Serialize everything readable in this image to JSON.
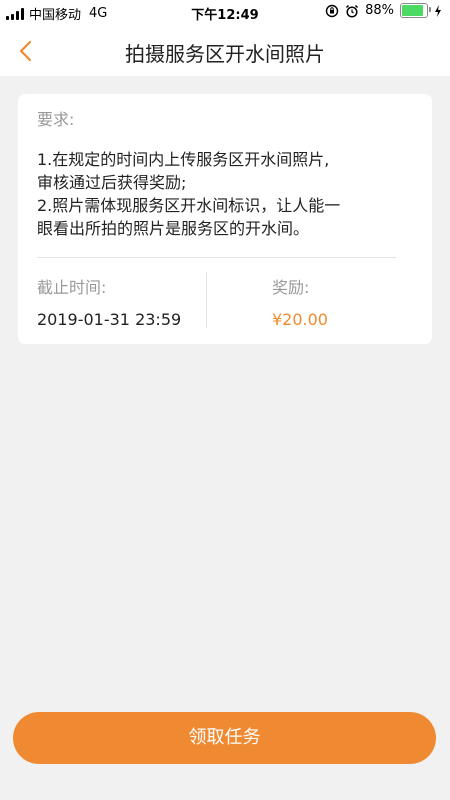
{
  "status_bar": {
    "carrier": "中国移动",
    "network": "4G",
    "time": "下午12:49",
    "battery_percent": "88%",
    "battery_level": 0.88,
    "battery_color": "#4cd964"
  },
  "nav": {
    "back_icon": "chevron-left-icon",
    "title": "拍摄服务区开水间照片",
    "accent_color": "#f08a32"
  },
  "task": {
    "requirements_label": "要求:",
    "requirements_text": "1.在规定的时间内上传服务区开水间照片,\n审核通过后获得奖励;\n2.照片需体现服务区开水间标识，让人能一\n眼看出所拍的照片是服务区的开水间。",
    "deadline_label": "截止时间:",
    "deadline_value": "2019-01-31 23:59",
    "reward_label": "奖励:",
    "reward_value": "¥20.00"
  },
  "actions": {
    "accept_label": "领取任务"
  }
}
